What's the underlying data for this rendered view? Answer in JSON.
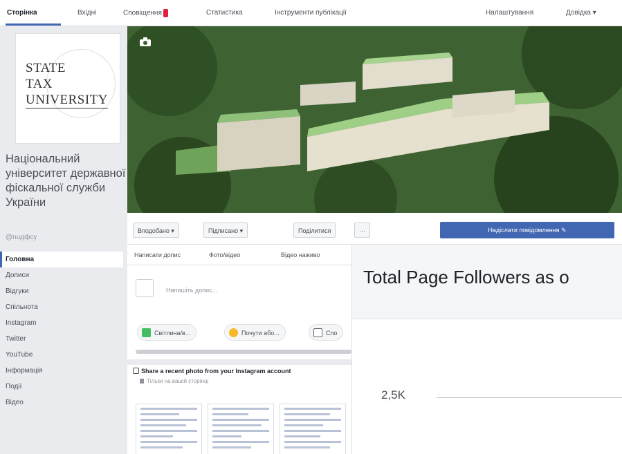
{
  "topbar": {
    "tabs": [
      {
        "label": "Сторінка",
        "active": true
      },
      {
        "label": "Вхідні",
        "active": false
      },
      {
        "label": "Сповіщення",
        "active": false
      },
      {
        "label": "Статистика",
        "active": false
      },
      {
        "label": "Інструменти публікації",
        "active": false
      }
    ],
    "settings_label": "Налаштування",
    "help_label": "Довідка ▾"
  },
  "page": {
    "logo_lines": [
      "STATE",
      "TAX",
      "UNIVERSITY"
    ],
    "name": "Національний університет державної фіскальної служби України",
    "handle": "@nuдфсу"
  },
  "nav": {
    "items": [
      {
        "label": "Головна",
        "active": true
      },
      {
        "label": "Дописи",
        "active": false
      },
      {
        "label": "Відгуки",
        "active": false
      },
      {
        "label": "Спільнота",
        "active": false
      },
      {
        "label": "Instagram",
        "active": false
      },
      {
        "label": "Twitter",
        "active": false
      },
      {
        "label": "YouTube",
        "active": false
      },
      {
        "label": "Інформація",
        "active": false
      },
      {
        "label": "Події",
        "active": false
      },
      {
        "label": "Відео",
        "active": false
      }
    ]
  },
  "actions": {
    "liked": "Вподобано ▾",
    "following": "Підписано ▾",
    "share": "Поділитися",
    "more": "···",
    "cta": "Надіслати повідомлення ✎"
  },
  "composer": {
    "tabs": [
      "Написати допис",
      "Фото/відео",
      "Відео наживо"
    ],
    "placeholder": "Напишіть допис...",
    "chips": [
      "Світлина/в...",
      "Почути або...",
      "Спо"
    ],
    "instagram_title": "Share a recent photo from your Instagram account",
    "instagram_sub": "Тільки на вашій сторінці"
  },
  "overlay": {
    "title": "Total Page Followers as o",
    "ytick": "2,5K"
  },
  "colors": {
    "accent": "#4267b2",
    "badge": "#e41e3f",
    "background": "#e9ebee"
  }
}
